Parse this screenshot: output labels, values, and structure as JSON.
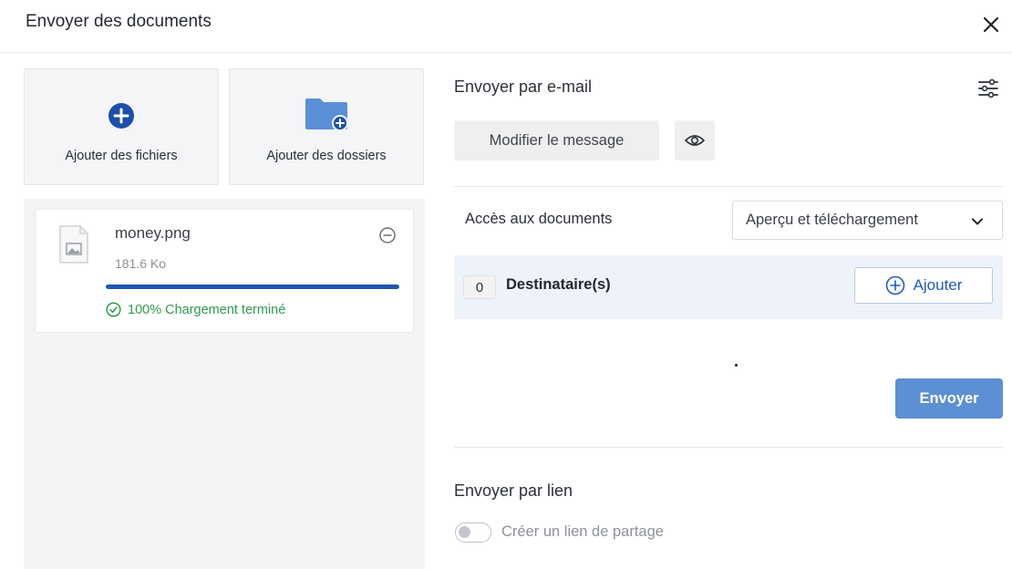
{
  "dialog": {
    "title": "Envoyer des documents"
  },
  "upload": {
    "add_files_label": "Ajouter des fichiers",
    "add_folders_label": "Ajouter des dossiers"
  },
  "file": {
    "name": "money.png",
    "size": "181.6 Ko",
    "progress_percent": 100,
    "status": "100% Chargement terminé"
  },
  "email_section": {
    "title": "Envoyer par e-mail",
    "edit_message_label": "Modifier le message",
    "access_label": "Accès aux documents",
    "access_selected": "Aperçu et téléchargement",
    "recipients_count": "0",
    "recipients_label": "Destinataire(s)",
    "add_label": "Ajouter",
    "send_label": "Envoyer"
  },
  "link_section": {
    "title": "Envoyer par lien",
    "toggle_label": "Créer un lien de partage",
    "toggle_on": false
  },
  "colors": {
    "accent": "#1e55b3",
    "send_button": "#5d8fd3",
    "success": "#2f9a4f",
    "recipients_bg": "#edf2fb"
  },
  "icons": [
    "close-icon",
    "add-circle-icon",
    "add-folder-icon",
    "image-file-icon",
    "remove-circle-icon",
    "check-circle-icon",
    "settings-sliders-icon",
    "eye-icon",
    "chevron-down-icon",
    "add-circle-outline-icon"
  ]
}
